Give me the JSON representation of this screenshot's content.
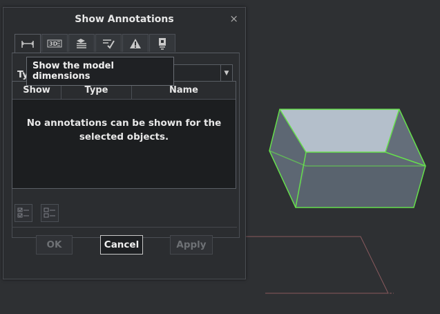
{
  "dialog": {
    "title": "Show Annotations",
    "close_glyph": "×",
    "tabs": [
      {
        "icon": "dimension-icon",
        "active": true
      },
      {
        "icon": "3d-text-icon",
        "active": false
      },
      {
        "icon": "datum-stack-icon",
        "active": false
      },
      {
        "icon": "check-list-icon",
        "active": false
      },
      {
        "icon": "warning-icon",
        "active": false
      },
      {
        "icon": "info-tag-icon",
        "active": false
      }
    ],
    "type_label": "Ty",
    "type_value": "",
    "tooltip": "Show the model dimensions",
    "table": {
      "columns": [
        "Show",
        "Type",
        "Name"
      ],
      "empty_message_line1": "No annotations can be shown for the",
      "empty_message_line2": "selected objects."
    },
    "buttons": {
      "ok": "OK",
      "cancel": "Cancel",
      "apply": "Apply"
    }
  },
  "colors": {
    "viewport_bg": "#2e3033",
    "box_face": "#b7c2cf",
    "box_edge": "#66e04c",
    "ghost_outline": "#8a5a5e"
  }
}
